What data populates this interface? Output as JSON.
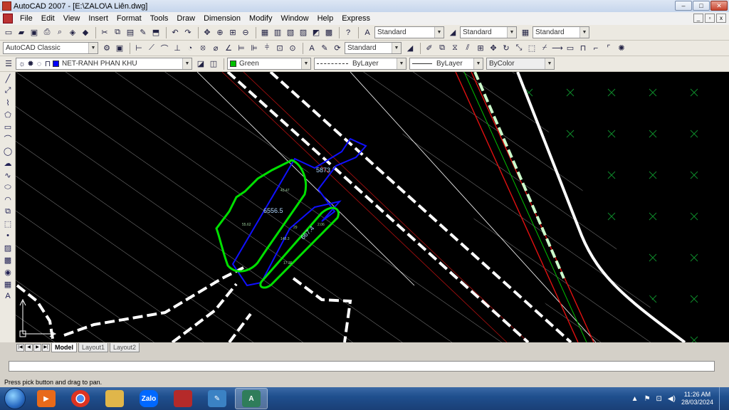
{
  "window": {
    "title": "AutoCAD 2007 - [E:\\ZALO\\A Liên.dwg]",
    "controls": [
      "–",
      "□",
      "✕"
    ],
    "doc_controls": [
      "_",
      "▫",
      "x"
    ]
  },
  "menubar": {
    "items": [
      "File",
      "Edit",
      "View",
      "Insert",
      "Format",
      "Tools",
      "Draw",
      "Dimension",
      "Modify",
      "Window",
      "Help",
      "Express"
    ]
  },
  "toolbar1": {
    "text_style": "Standard",
    "dim_style": "Standard",
    "table_style": "Standard"
  },
  "toolbar2": {
    "workspace": "AutoCAD Classic",
    "mleader_style": "Standard"
  },
  "toolbar3": {
    "layer": "NET-RANH PHAN KHU",
    "layer_color": "#0000ff",
    "color": "Green",
    "color_swatch": "#00c000",
    "linetype": "ByLayer",
    "lineweight": "ByLayer",
    "plotstyle": "ByColor"
  },
  "drawing": {
    "labels": [
      "5873",
      "6556.5",
      "667.4",
      "43.47",
      "55.62",
      "148.3",
      "17.36",
      "2.06",
      "29"
    ],
    "colors": {
      "background": "#000000",
      "hatch": "#ffffff",
      "parcel_green": "#00e000",
      "parcel_blue": "#1010ff",
      "road": "#ffffff",
      "red_line": "#e01010",
      "green_line": "#00c000"
    }
  },
  "tabs": {
    "model": "Model",
    "layout1": "Layout1",
    "layout2": "Layout2"
  },
  "command": {
    "input_value": ""
  },
  "status": {
    "message": "Press pick button and drag to pan."
  },
  "taskbar": {
    "apps": [
      {
        "name": "media-player",
        "label": "",
        "color": "#e86a1a"
      },
      {
        "name": "chrome",
        "label": "",
        "color": "#dd3322"
      },
      {
        "name": "file-explorer",
        "label": "",
        "color": "#e0b64a"
      },
      {
        "name": "zalo",
        "label": "Zalo",
        "color": "#0068ff"
      },
      {
        "name": "store-app",
        "label": "",
        "color": "#b52a2a"
      },
      {
        "name": "paint",
        "label": "",
        "color": "#3b82c4"
      },
      {
        "name": "autocad",
        "label": "A",
        "color": "#2f7d5a"
      }
    ],
    "time": "11:26 AM",
    "date": "28/03/2024"
  },
  "icons": {
    "layer": "layer-icon",
    "bulb": "lightbulb-icon",
    "sun": "sun-icon",
    "lock": "lock-icon"
  }
}
